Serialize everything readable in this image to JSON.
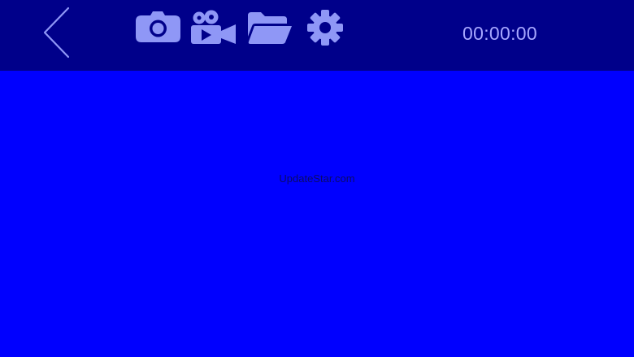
{
  "toolbar": {
    "timer": "00:00:00",
    "icons": {
      "back": "chevron-left-icon",
      "camera": "camera-icon",
      "video": "video-camera-icon",
      "folder": "folder-open-icon",
      "settings": "gear-icon"
    }
  },
  "preview": {
    "watermark": "UpdateStar.com"
  },
  "colors": {
    "preview_background": "#0000ff",
    "toolbar_background": "#00008a",
    "icon_color": "#8f97f6",
    "timer_color": "#a8a8ff",
    "watermark_color": "#0b0b66"
  }
}
